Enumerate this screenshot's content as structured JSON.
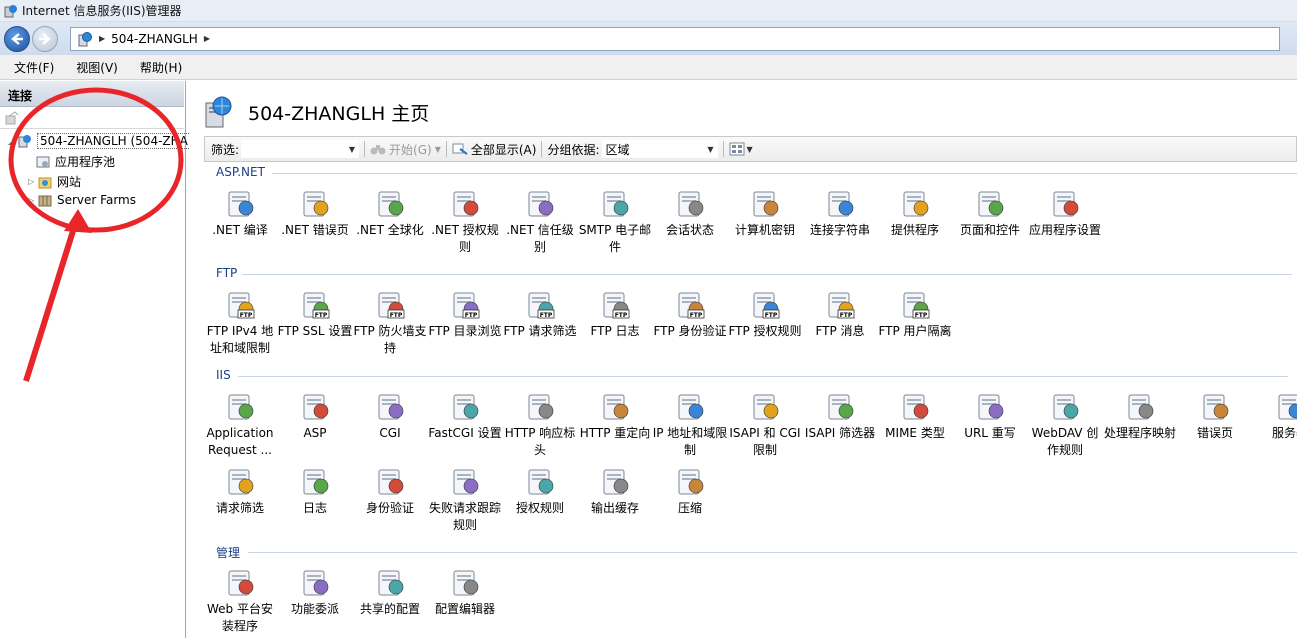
{
  "window": {
    "title": "Internet 信息服务(IIS)管理器"
  },
  "address": {
    "crumb": "504-ZHANGLH"
  },
  "menu": [
    "文件(F)",
    "视图(V)",
    "帮助(H)"
  ],
  "connections": {
    "header": "连接",
    "tree": [
      {
        "label": "504-ZHANGLH (504-ZHA",
        "selected": true
      },
      {
        "label": "应用程序池"
      },
      {
        "label": "网站"
      },
      {
        "label": "Server Farms"
      }
    ]
  },
  "main": {
    "title": "504-ZHANGLH 主页",
    "filter_label": "筛选:",
    "go_label": "开始(G)",
    "showall_label": "全部显示(A)",
    "groupby_label": "分组依据:",
    "groupby_value": "区域"
  },
  "groups": [
    {
      "name": "ASP.NET",
      "items": [
        {
          "label": ".NET 编译",
          "icon": "stack-icon"
        },
        {
          "label": ".NET 错误页",
          "icon": "error-page-icon"
        },
        {
          "label": ".NET 全球化",
          "icon": "globe-icon"
        },
        {
          "label": ".NET 授权规则",
          "icon": "lock-doc-icon"
        },
        {
          "label": ".NET 信任级别",
          "icon": "globe-check-icon"
        },
        {
          "label": "SMTP 电子邮件",
          "icon": "mail-screen-icon"
        },
        {
          "label": "会话状态",
          "icon": "user-diamond-icon"
        },
        {
          "label": "计算机密钥",
          "icon": "server-key-icon"
        },
        {
          "label": "连接字符串",
          "icon": "db-ab-icon"
        },
        {
          "label": "提供程序",
          "icon": "users-db-icon"
        },
        {
          "label": "页面和控件",
          "icon": "pages-icon"
        },
        {
          "label": "应用程序设置",
          "icon": "checklist-icon"
        }
      ]
    },
    {
      "name": "FTP",
      "items": [
        {
          "label": "FTP IPv4 地址和域限制",
          "icon": "ftp-network-icon"
        },
        {
          "label": "FTP SSL 设置",
          "icon": "ftp-lock-icon"
        },
        {
          "label": "FTP 防火墙支持",
          "icon": "ftp-firewall-icon"
        },
        {
          "label": "FTP 目录浏览",
          "icon": "ftp-browse-icon"
        },
        {
          "label": "FTP 请求筛选",
          "icon": "ftp-filter-icon"
        },
        {
          "label": "FTP 日志",
          "icon": "ftp-log-icon"
        },
        {
          "label": "FTP 身份验证",
          "icon": "ftp-auth-icon"
        },
        {
          "label": "FTP 授权规则",
          "icon": "ftp-keys-icon"
        },
        {
          "label": "FTP 消息",
          "icon": "ftp-message-icon"
        },
        {
          "label": "FTP 用户隔离",
          "icon": "ftp-users-icon"
        }
      ]
    },
    {
      "name": "IIS",
      "items": [
        {
          "label": "Application Request ...",
          "icon": "arr-icon"
        },
        {
          "label": "ASP",
          "icon": "asp-icon"
        },
        {
          "label": "CGI",
          "icon": "cgi-icon"
        },
        {
          "label": "FastCGI 设置",
          "icon": "fastcgi-icon"
        },
        {
          "label": "HTTP 响应标头",
          "icon": "headers-icon"
        },
        {
          "label": "HTTP 重定向",
          "icon": "redirect-icon"
        },
        {
          "label": "IP 地址和域限制",
          "icon": "ip-restrict-icon"
        },
        {
          "label": "ISAPI 和 CGI 限制",
          "icon": "isapi-cgi-icon"
        },
        {
          "label": "ISAPI 筛选器",
          "icon": "isapi-filter-icon"
        },
        {
          "label": "MIME 类型",
          "icon": "mime-icon"
        },
        {
          "label": "URL 重写",
          "icon": "url-rewrite-icon"
        },
        {
          "label": "WebDAV 创作规则",
          "icon": "webdav-icon"
        },
        {
          "label": "处理程序映射",
          "icon": "handler-icon"
        },
        {
          "label": "错误页",
          "icon": "error-404-icon"
        },
        {
          "label": "服务器",
          "icon": "server-cert-icon"
        },
        {
          "label": "请求筛选",
          "icon": "request-filter-icon"
        },
        {
          "label": "日志",
          "icon": "log-icon"
        },
        {
          "label": "身份验证",
          "icon": "auth-icon"
        },
        {
          "label": "失败请求跟踪规则",
          "icon": "failed-trace-icon"
        },
        {
          "label": "授权规则",
          "icon": "authz-icon"
        },
        {
          "label": "输出缓存",
          "icon": "output-cache-icon"
        },
        {
          "label": "压缩",
          "icon": "compress-icon"
        }
      ]
    },
    {
      "name": "管理",
      "items": [
        {
          "label": "Web 平台安装程序",
          "icon": "webpi-icon"
        },
        {
          "label": "功能委派",
          "icon": "delegation-icon"
        },
        {
          "label": "共享的配置",
          "icon": "shared-config-icon"
        },
        {
          "label": "配置编辑器",
          "icon": "config-editor-icon"
        }
      ]
    }
  ]
}
